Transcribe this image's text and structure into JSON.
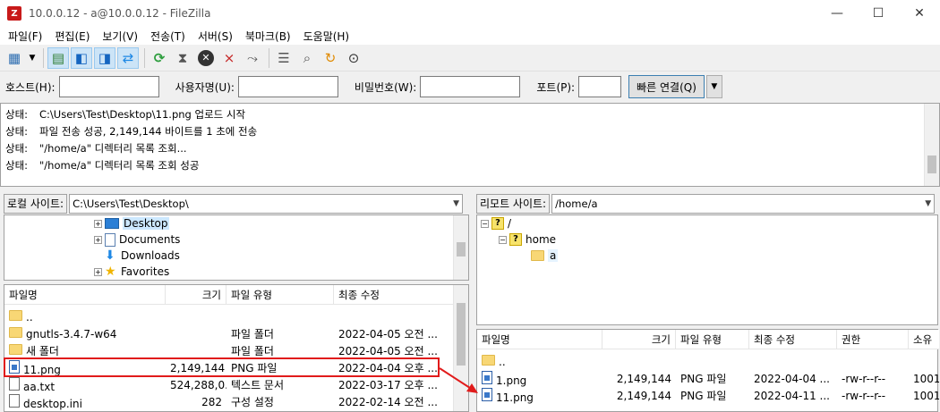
{
  "window": {
    "title": "10.0.0.12 - a@10.0.0.12 - FileZilla",
    "app_icon_letter": "Z"
  },
  "menu": [
    "파일(F)",
    "편집(E)",
    "보기(V)",
    "전송(T)",
    "서버(S)",
    "북마크(B)",
    "도움말(H)"
  ],
  "quickconnect": {
    "host_label": "호스트(H):",
    "user_label": "사용자명(U):",
    "pass_label": "비밀번호(W):",
    "port_label": "포트(P):",
    "connect_label": "빠른 연결(Q)"
  },
  "log": [
    {
      "label": "상태:",
      "text": "C:\\Users\\Test\\Desktop\\11.png 업로드 시작"
    },
    {
      "label": "상태:",
      "text": "파일 전송 성공, 2,149,144 바이트를 1 초에 전송"
    },
    {
      "label": "상태:",
      "text": "\"/home/a\" 디렉터리 목록 조회..."
    },
    {
      "label": "상태:",
      "text": "\"/home/a\" 디렉터리 목록 조회 성공"
    }
  ],
  "local": {
    "site_label": "로컬 사이트:",
    "path": "C:\\Users\\Test\\Desktop\\",
    "tree": [
      {
        "name": "Desktop",
        "icon": "desktop-icon"
      },
      {
        "name": "Documents",
        "icon": "documents-icon"
      },
      {
        "name": "Downloads",
        "icon": "downloads-icon"
      },
      {
        "name": "Favorites",
        "icon": "favorites-icon"
      }
    ],
    "columns": {
      "name": "파일명",
      "size": "크기",
      "type": "파일 유형",
      "modified": "최종 수정"
    },
    "files": [
      {
        "name": "..",
        "size": "",
        "type": "",
        "modified": "",
        "icon": "folder-icon"
      },
      {
        "name": "gnutls-3.4.7-w64",
        "size": "",
        "type": "파일 폴더",
        "modified": "2022-04-05 오전 ...",
        "icon": "folder-icon"
      },
      {
        "name": "새 폴더",
        "size": "",
        "type": "파일 폴더",
        "modified": "2022-04-05 오전 ...",
        "icon": "folder-icon"
      },
      {
        "name": "11.png",
        "size": "2,149,144",
        "type": "PNG 파일",
        "modified": "2022-04-04 오후 ...",
        "icon": "png-file-icon"
      },
      {
        "name": "aa.txt",
        "size": "524,288,0...",
        "type": "텍스트 문서",
        "modified": "2022-03-17 오후 ...",
        "icon": "text-file-icon"
      },
      {
        "name": "desktop.ini",
        "size": "282",
        "type": "구성 설정",
        "modified": "2022-02-14 오전 ...",
        "icon": "ini-file-icon"
      }
    ]
  },
  "remote": {
    "site_label": "리모트 사이트:",
    "path": "/home/a",
    "tree": [
      {
        "name": "/"
      },
      {
        "name": "home"
      },
      {
        "name": "a"
      }
    ],
    "columns": {
      "name": "파일명",
      "size": "크기",
      "type": "파일 유형",
      "modified": "최종 수정",
      "perms": "권한",
      "owner": "소유"
    },
    "files": [
      {
        "name": "..",
        "size": "",
        "type": "",
        "modified": "",
        "perms": "",
        "owner": "",
        "icon": "folder-icon"
      },
      {
        "name": "1.png",
        "size": "2,149,144",
        "type": "PNG 파일",
        "modified": "2022-04-04 ...",
        "perms": "-rw-r--r--",
        "owner": "1001",
        "icon": "png-file-icon"
      },
      {
        "name": "11.png",
        "size": "2,149,144",
        "type": "PNG 파일",
        "modified": "2022-04-11 ...",
        "perms": "-rw-r--r--",
        "owner": "1001",
        "icon": "png-file-icon"
      }
    ]
  },
  "colors": {
    "highlight": "#e11b1b",
    "active_tool": "#cce4f7"
  }
}
